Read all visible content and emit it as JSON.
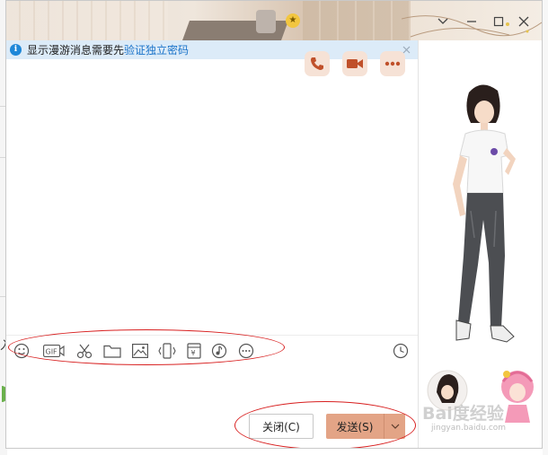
{
  "notice": {
    "text": "显示漫游消息需要先",
    "link": "验证独立密码"
  },
  "buttons": {
    "close_label": "关闭(C)",
    "send_label": "发送(S)"
  },
  "background": {
    "left_text": "入"
  },
  "watermark": {
    "text": "Bai度经验",
    "sub": "jingyan.baidu.com"
  },
  "window_controls": [
    "chevron-down-icon",
    "minimize-icon",
    "maximize-icon",
    "close-icon"
  ],
  "chat_actions": [
    "phone-icon",
    "video-icon",
    "more-icon"
  ],
  "toolbar": [
    "emoji-icon",
    "gif-icon",
    "screenshot-scissors-icon",
    "folder-icon",
    "image-icon",
    "shake-icon",
    "red-packet-icon",
    "music-icon",
    "more-icon"
  ],
  "colors": {
    "accent": "#e3a486",
    "notice_bg": "#dcebf8",
    "link": "#1a73c9",
    "annotation": "#d82020"
  }
}
